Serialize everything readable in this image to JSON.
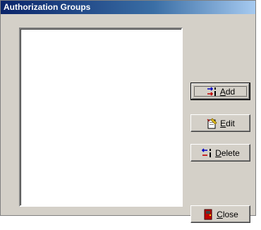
{
  "window": {
    "title": "Authorization Groups"
  },
  "list": {
    "items": []
  },
  "buttons": {
    "add": {
      "label_access": "A",
      "label_rest": "dd",
      "icon": "add-icon"
    },
    "edit": {
      "label_access": "E",
      "label_rest": "dit",
      "icon": "edit-icon"
    },
    "delete": {
      "label_access": "D",
      "label_rest": "elete",
      "icon": "delete-icon"
    },
    "close": {
      "label_access": "C",
      "label_rest": "lose",
      "icon": "close-door-icon"
    }
  },
  "colors": {
    "face": "#d4d0c8",
    "title_start": "#0a246a",
    "title_end": "#a6caf0"
  }
}
